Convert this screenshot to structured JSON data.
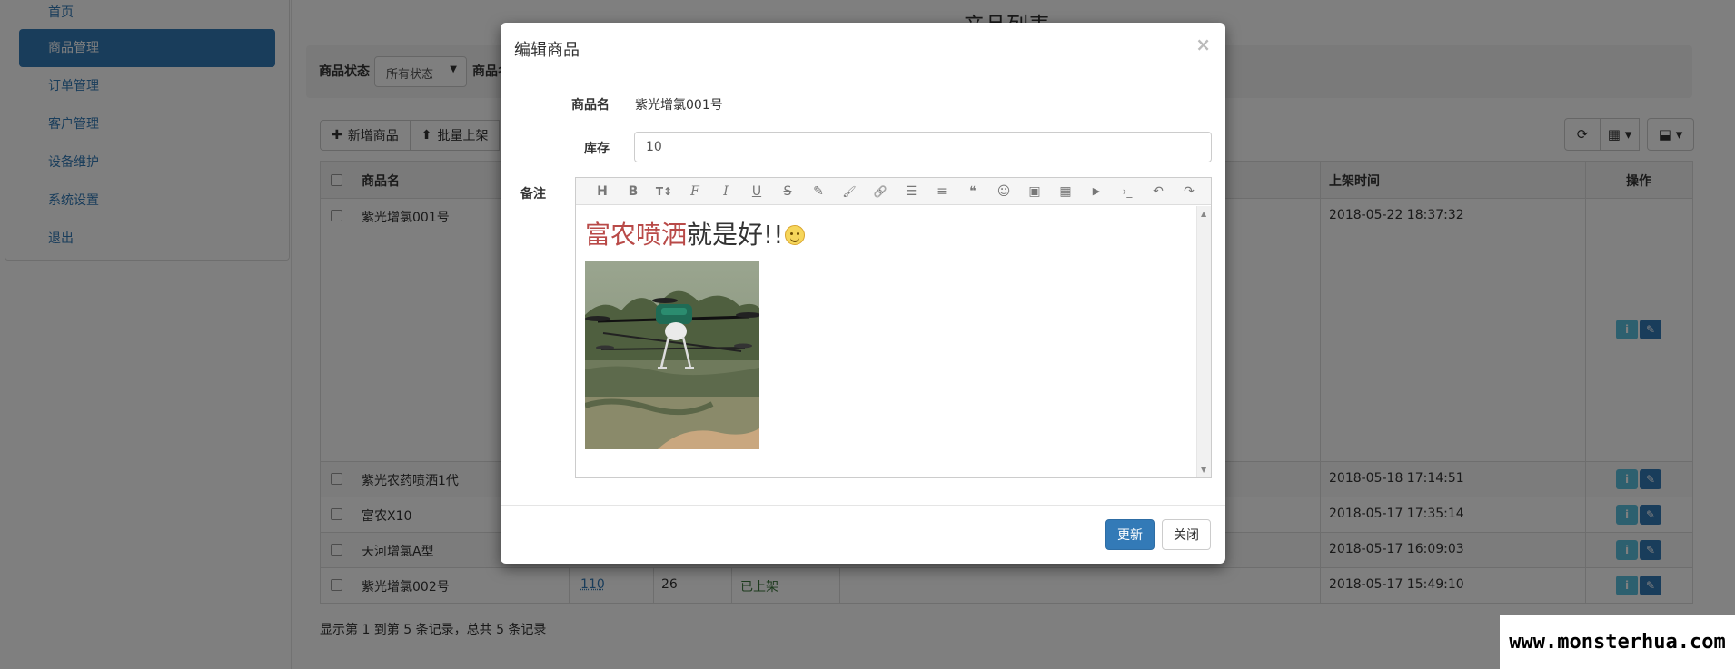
{
  "sidebar": {
    "items": [
      {
        "label": "首页"
      },
      {
        "label": "商品管理"
      },
      {
        "label": "订单管理"
      },
      {
        "label": "客户管理"
      },
      {
        "label": "设备维护"
      },
      {
        "label": "系统设置"
      },
      {
        "label": "退出"
      }
    ],
    "active_color": "#337ab7"
  },
  "page": {
    "title": "产品列表"
  },
  "filter": {
    "status_label": "商品状态",
    "status_value": "所有状态",
    "name_label": "商品名"
  },
  "toolbar": {
    "add_label": "新增商品",
    "batch_label": "批量上架"
  },
  "table": {
    "headers": {
      "name": "商品名",
      "shelf_time": "上架时间",
      "action": "操作"
    },
    "rows": [
      {
        "name": "紫光增氯001号",
        "stock": "",
        "count": "",
        "status": "",
        "time": "2018-05-22 18:37:32"
      },
      {
        "name": "紫光农药喷洒1代",
        "stock": "",
        "count": "",
        "status": "",
        "time": "2018-05-18 17:14:51"
      },
      {
        "name": "富农X10",
        "stock": "",
        "count": "",
        "status": "",
        "time": "2018-05-17 17:35:14"
      },
      {
        "name": "天河增氯A型",
        "stock": "",
        "count": "",
        "status": "",
        "time": "2018-05-17 16:09:03"
      },
      {
        "name": "紫光增氯002号",
        "stock": "110",
        "count": "26",
        "status": "已上架",
        "time": "2018-05-17 15:49:10"
      }
    ]
  },
  "footer": {
    "info": "显示第 1 到第 5 条记录，总共 5 条记录"
  },
  "modal": {
    "title": "编辑商品",
    "close_glyph": "×",
    "name_label": "商品名",
    "name_value": "紫光增氯001号",
    "stock_label": "库存",
    "stock_value": "10",
    "note_label": "备注",
    "editor": {
      "tools": [
        "H",
        "B",
        "T↕",
        "F",
        "I",
        "U",
        "S",
        "✎",
        "🖌",
        "🔗",
        "☰",
        "≡",
        "❝",
        "☺",
        "▣",
        "▦",
        "▶",
        "›_",
        "↶",
        "↷"
      ],
      "text_red": "富农喷洒",
      "text_rest": "就是好!!"
    },
    "update_label": "更新",
    "close_label": "关闭"
  },
  "watermark": "www.monsterhua.com",
  "colors": {
    "primary": "#337ab7",
    "info": "#5bc0de",
    "success_text": "#3c763d",
    "editor_red": "#b94a48"
  }
}
